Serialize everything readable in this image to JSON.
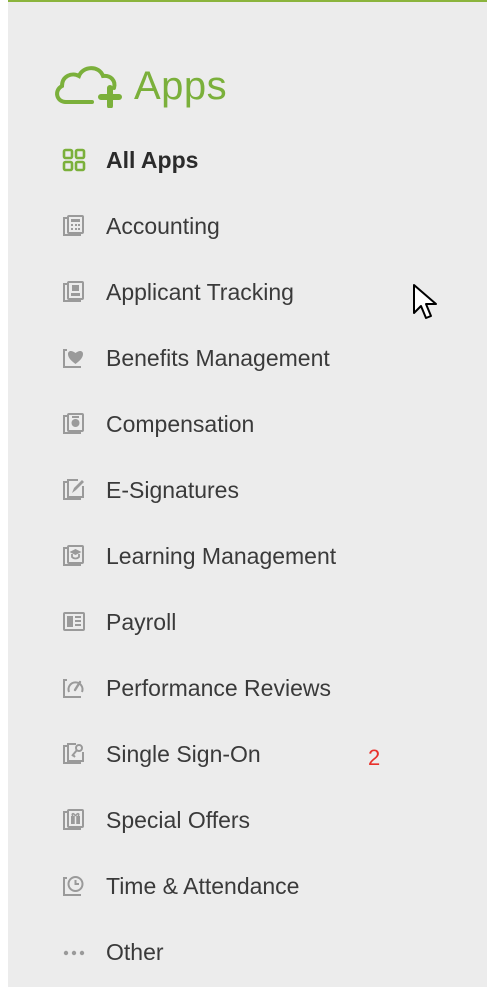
{
  "colors": {
    "accent": "#7bb03b",
    "icon_gray": "#9a9a9a",
    "text": "#3a3a3a",
    "badge": "#e8302a"
  },
  "header": {
    "icon": "cloud-plus-icon",
    "title": "Apps"
  },
  "nav": {
    "items": [
      {
        "label": "All Apps",
        "icon": "grid-icon",
        "active": true
      },
      {
        "label": "Accounting",
        "icon": "calculator-icon"
      },
      {
        "label": "Applicant Tracking",
        "icon": "applicant-icon"
      },
      {
        "label": "Benefits Management",
        "icon": "heart-icon"
      },
      {
        "label": "Compensation",
        "icon": "compensation-icon"
      },
      {
        "label": "E-Signatures",
        "icon": "signature-icon"
      },
      {
        "label": "Learning Management",
        "icon": "graduation-cap-icon"
      },
      {
        "label": "Payroll",
        "icon": "payroll-icon"
      },
      {
        "label": "Performance Reviews",
        "icon": "gauge-icon"
      },
      {
        "label": "Single Sign-On",
        "icon": "key-icon"
      },
      {
        "label": "Special Offers",
        "icon": "gift-icon"
      },
      {
        "label": "Time & Attendance",
        "icon": "clock-icon"
      },
      {
        "label": "Other",
        "icon": "ellipsis-icon"
      }
    ]
  },
  "annotation": {
    "badge": "2"
  }
}
